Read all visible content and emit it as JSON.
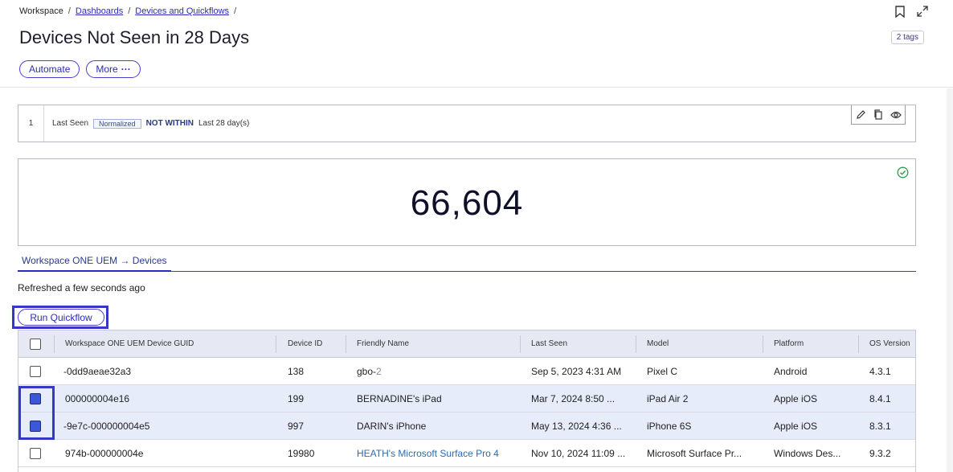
{
  "breadcrumb": {
    "root": "Workspace",
    "sep": "/",
    "items": [
      "Dashboards",
      "Devices and Quickflows"
    ]
  },
  "page": {
    "title": "Devices Not Seen in 28 Days",
    "tags": "2 tags"
  },
  "actions": {
    "automate": "Automate",
    "more": "More",
    "more_glyph": "···"
  },
  "filter": {
    "row_number": "1",
    "attribute": "Last Seen",
    "badge": "Normalized",
    "operator": "NOT WITHIN",
    "value": "Last 28 day(s)"
  },
  "count": {
    "value": "66,604"
  },
  "tab": {
    "label": "Workspace ONE UEM → Devices"
  },
  "status": {
    "refreshed": "Refreshed a few seconds ago"
  },
  "quickflow": {
    "label": "Run Quickflow"
  },
  "table": {
    "columns": [
      "Workspace ONE UEM Device GUID",
      "Device ID",
      "Friendly Name",
      "Last Seen",
      "Model",
      "Platform",
      "OS Version"
    ],
    "rows": [
      {
        "guid": "-0dd9aeae32a3",
        "device_id": "138",
        "friendly": "gbo-",
        "friendly_suffix": "2",
        "last_seen": "Sep 5, 2023 4:31 AM",
        "model": "Pixel C",
        "platform": "Android",
        "os": "4.3.1",
        "checked": false
      },
      {
        "guid": "000000004e16",
        "device_id": "199",
        "friendly": "BERNADINE's iPad",
        "friendly_suffix": "",
        "last_seen": "Mar 7, 2024 8:50 ...",
        "model": "iPad Air 2",
        "platform": "Apple iOS",
        "os": "8.4.1",
        "checked": true
      },
      {
        "guid": "-9e7c-000000004e5",
        "device_id": "997",
        "friendly": "DARIN's iPhone",
        "friendly_suffix": "",
        "last_seen": "May 13, 2024 4:36 ...",
        "model": "iPhone 6S",
        "platform": "Apple iOS",
        "os": "8.3.1",
        "checked": true
      },
      {
        "guid": "974b-000000004e",
        "device_id": "19980",
        "friendly": "HEATH's Microsoft Surface Pro 4",
        "friendly_suffix": "",
        "last_seen": "Nov 10, 2024 11:09 ...",
        "model": "Microsoft Surface Pr...",
        "platform": "Windows Des...",
        "os": "9.3.2",
        "checked": false
      }
    ]
  },
  "colors": {
    "accent": "#2b2bbd",
    "highlight_frame": "#3636c8",
    "success": "#2e9e4f",
    "checkbox_fill": "#3a58d8"
  }
}
